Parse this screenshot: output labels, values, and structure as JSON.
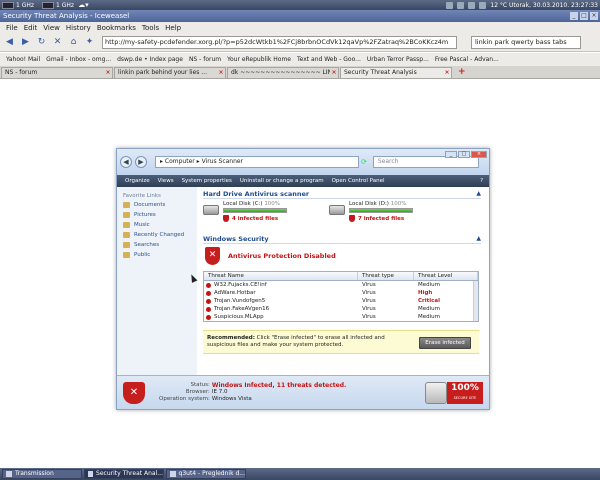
{
  "top_panel": {
    "cpu1": "1 GHz",
    "cpu2": "1 GHz",
    "clock": "12 °C  Utorak, 30.03.2010. 23:27:33"
  },
  "window": {
    "title": "Security Threat Analysis - Iceweasel"
  },
  "menu": [
    "File",
    "Edit",
    "View",
    "History",
    "Bookmarks",
    "Tools",
    "Help"
  ],
  "navigation": {
    "url": "http://my-safety-pcdefender.xorg.pl/?p=p52dcWtkb1%2FCj8brbnOCdVk12qaVp%2FZatraq%2BCoKKcz4m",
    "search_value": "linkin park qwerty bass tabs"
  },
  "bookmarks": [
    "Yahoo! Mail",
    "Gmail - Inbox - omg...",
    "dswp.de • Index page",
    "NS - forum",
    "Your eRepublik Home",
    "Text and Web - Goo...",
    "Urban Terror Passp...",
    "Free Pascal - Advan..."
  ],
  "tabs": [
    {
      "label": "NS - forum",
      "active": false
    },
    {
      "label": "linkin park behind your lies ...",
      "active": false
    },
    {
      "label": "dk ~~~~~~~~~~~~~~~~ LIN...",
      "active": false
    },
    {
      "label": "Security Threat Analysis",
      "active": true
    }
  ],
  "explorer": {
    "breadcrumb": "▸ Computer ▸ Virus Scanner",
    "search_placeholder": "Search",
    "toolbar": {
      "organize": "Organize",
      "views": "Views",
      "system_properties": "System properties",
      "uninstall": "Uninstall or change a program",
      "control_panel": "Open Control Panel"
    },
    "sidebar": {
      "heading": "Favorite Links",
      "items": [
        "Documents",
        "Pictures",
        "Music",
        "Recently Changed",
        "Searches",
        "Public"
      ]
    },
    "hard_drive_section": "Hard Drive Antivirus scanner",
    "disks": [
      {
        "label": "Local Disk (C:)",
        "percent": "100%",
        "fill": 100,
        "infected": "4 infected files"
      },
      {
        "label": "Local Disk (D:)",
        "percent": "100%",
        "fill": 100,
        "infected": "7 infected files"
      }
    ],
    "security_section": "Windows Security",
    "alert": "Antivirus Protection Disabled",
    "threat_headers": [
      "Threat Name",
      "Threat type",
      "Threat Level"
    ],
    "threats": [
      {
        "name": "W32.Fujacks.CE!inf",
        "type": "Virus",
        "level": "Medium",
        "color": "#222222"
      },
      {
        "name": "AdWare.Hotbar",
        "type": "Virus",
        "level": "High",
        "color": "#c31414"
      },
      {
        "name": "Trojan.Vundofgen5",
        "type": "Virus",
        "level": "Critical",
        "color": "#c31414"
      },
      {
        "name": "Trojan.FakeAVgen16",
        "type": "Virus",
        "level": "Medium",
        "color": "#222222"
      },
      {
        "name": "Suspicious.MLApp",
        "type": "Virus",
        "level": "Medium",
        "color": "#222222"
      }
    ],
    "recommend_bold": "Recommended:",
    "recommend_text": " Click \"Erase infected\" to erase all infected and suspicious files and make your system protected.",
    "erase_button": "Erase infected",
    "status": {
      "label_status": "Status:",
      "label_browser": "Browser:",
      "label_os": "Operation system:",
      "value_status": "Windows Infected, 11 threats detected.",
      "value_browser": "IE 7.0",
      "value_os": "Windows Vista",
      "badge_pct": "100%",
      "badge_sub": "SECURE SITE"
    }
  },
  "taskbar": [
    "Transmission",
    "Security Threat Anal...",
    "q3ut4 - Preglednik d..."
  ]
}
